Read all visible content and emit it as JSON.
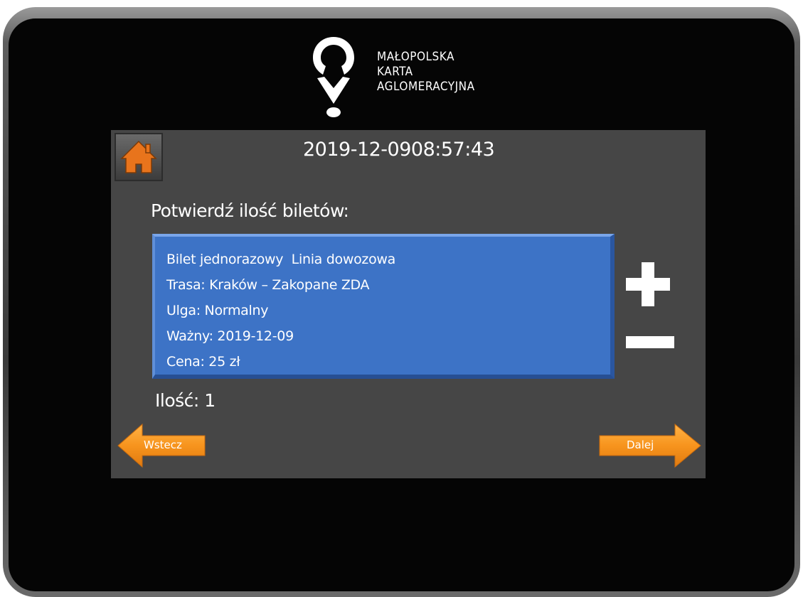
{
  "header": {
    "logo_lines": [
      "MAŁOPOLSKA",
      "KARTA",
      "AGLOMERACYJNA"
    ]
  },
  "status": {
    "date": "2019-12-09",
    "time": "08:57:43"
  },
  "main": {
    "prompt": "Potwierdź ilość biletów:",
    "ticket": {
      "line1": "Bilet jednorazowy  Linia dowozowa",
      "line2": "Trasa: Kraków – Zakopane ZDA",
      "line3": "Ulga: Normalny",
      "line4": "Ważny: 2019-12-09",
      "line5": "Cena: 25 zł"
    },
    "quantity": "Ilość: 1"
  },
  "nav": {
    "back_label": "Wstecz",
    "next_label": "Dalej"
  },
  "icons": {
    "home": "home-icon",
    "plus": "plus-icon",
    "minus": "minus-icon"
  },
  "colors": {
    "panel": "#464646",
    "ticket": "#3d73c6",
    "accent": "#f7941d"
  }
}
